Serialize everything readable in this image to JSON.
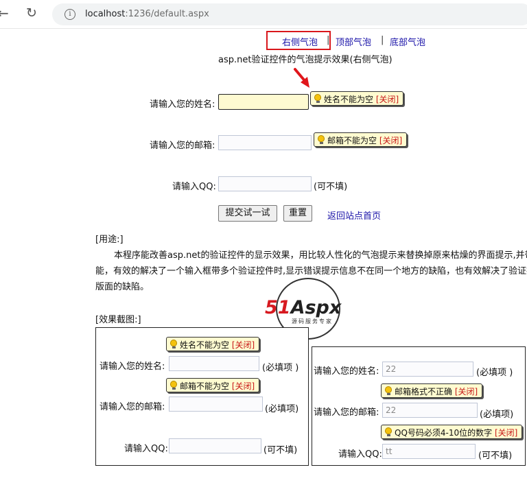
{
  "browser": {
    "back_icon": "arrow-left-icon",
    "reload_icon": "reload-icon",
    "info_icon": "info-icon",
    "url_host": "localhost",
    "url_path": ":1236/default.aspx"
  },
  "nav": {
    "right_bubble": "右侧气泡",
    "top_bubble": "顶部气泡",
    "bottom_bubble": "底部气泡",
    "separator": "|"
  },
  "page": {
    "title": "asp.net验证控件的气泡提示效果(右侧气泡)",
    "name_label": "请输入您的姓名:",
    "email_label": "请输入您的邮箱:",
    "qq_label": "请输入QQ:",
    "qq_optional": "(可不填)",
    "name_error": "姓名不能为空",
    "email_error": "邮箱不能为空",
    "close_label": "[关闭]",
    "submit_label": "提交试一试",
    "reset_label": "重置",
    "back_home_label": "返回站点首页",
    "usage_heading": "[用途:]",
    "usage_line1": "本程序能改善asp.net的验证控件的显示效果，用比较人性化的气泡提示来替换掉原来枯燥的界面提示,并带",
    "usage_line2": "能，有效的解决了一个输入框带多个验证控件时,显示错误提示信息不在同一个地方的缺陷，也有效解决了验证控",
    "usage_line3": "版面的缺陷。",
    "screenshot_heading": "[效果截图:]"
  },
  "logo": {
    "part1": "51",
    "part2": "Aspx",
    "subtitle": "源码服务专家"
  },
  "shot_left": {
    "name_error": "姓名不能为空",
    "email_error": "邮箱不能为空",
    "close_label": "[关闭]",
    "name_label": "请输入您的姓名:",
    "email_label": "请输入您的邮箱:",
    "qq_label": "请输入QQ:",
    "required": "(必填项 )",
    "required2": "(必填项)",
    "optional": "(可不填)"
  },
  "shot_right": {
    "name_label": "请输入您的姓名:",
    "name_value": "22",
    "required": "(必填项 )",
    "email_error": "邮箱格式不正确",
    "email_label": "请输入您的邮箱:",
    "email_value": "22",
    "required2": "(必填项)",
    "qq_error": "QQ号码必须4-10位的数字",
    "close_label": "[关闭]",
    "qq_label": "请输入QQ:",
    "qq_value": "tt",
    "optional": "(可不填)"
  },
  "colors": {
    "link": "#1a13a8",
    "highlight_border": "#d9171b",
    "bubble_bg": "#fefbd0",
    "error_input_bg": "#fefad1",
    "close_text": "#c81717"
  }
}
